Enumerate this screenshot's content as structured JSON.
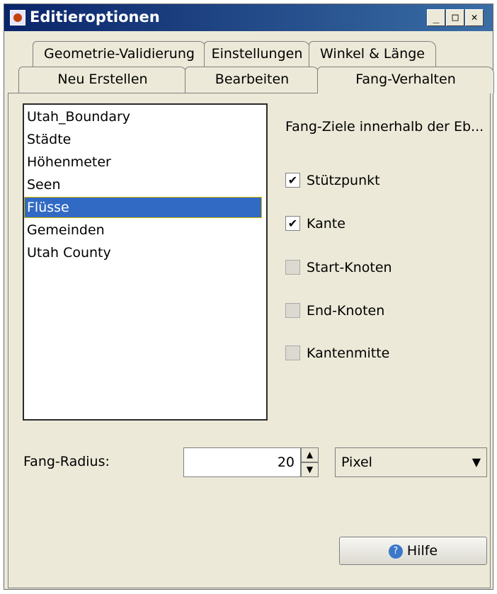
{
  "window": {
    "title": "Editieroptionen",
    "controls": {
      "minimize": "_",
      "maximize": "□",
      "close": "✕"
    }
  },
  "tabs": {
    "row1": [
      {
        "label": "Geometrie-Validierung"
      },
      {
        "label": "Einstellungen"
      },
      {
        "label": "Winkel & Länge"
      }
    ],
    "row2": [
      {
        "label": "Neu Erstellen"
      },
      {
        "label": "Bearbeiten"
      },
      {
        "label": "Fang-Verhalten",
        "active": true
      }
    ]
  },
  "layers": {
    "items": [
      "Utah_Boundary",
      "Städte",
      "Höhenmeter",
      "Seen",
      "Flüsse",
      "Gemeinden",
      "Utah County"
    ],
    "selected": "Flüsse"
  },
  "snap_targets": {
    "label": "Fang-Ziele innerhalb der Eb...",
    "options": [
      {
        "label": "Stützpunkt",
        "checked": true
      },
      {
        "label": "Kante",
        "checked": true
      },
      {
        "label": "Start-Knoten",
        "checked": false
      },
      {
        "label": "End-Knoten",
        "checked": false
      },
      {
        "label": "Kantenmitte",
        "checked": false
      }
    ]
  },
  "radius": {
    "label": "Fang-Radius:",
    "value": "20",
    "unit": "Pixel"
  },
  "help": {
    "label": "Hilfe",
    "icon": "help-icon"
  },
  "colors": {
    "selection": "#316ac5",
    "title_bar": "#0a246a"
  }
}
